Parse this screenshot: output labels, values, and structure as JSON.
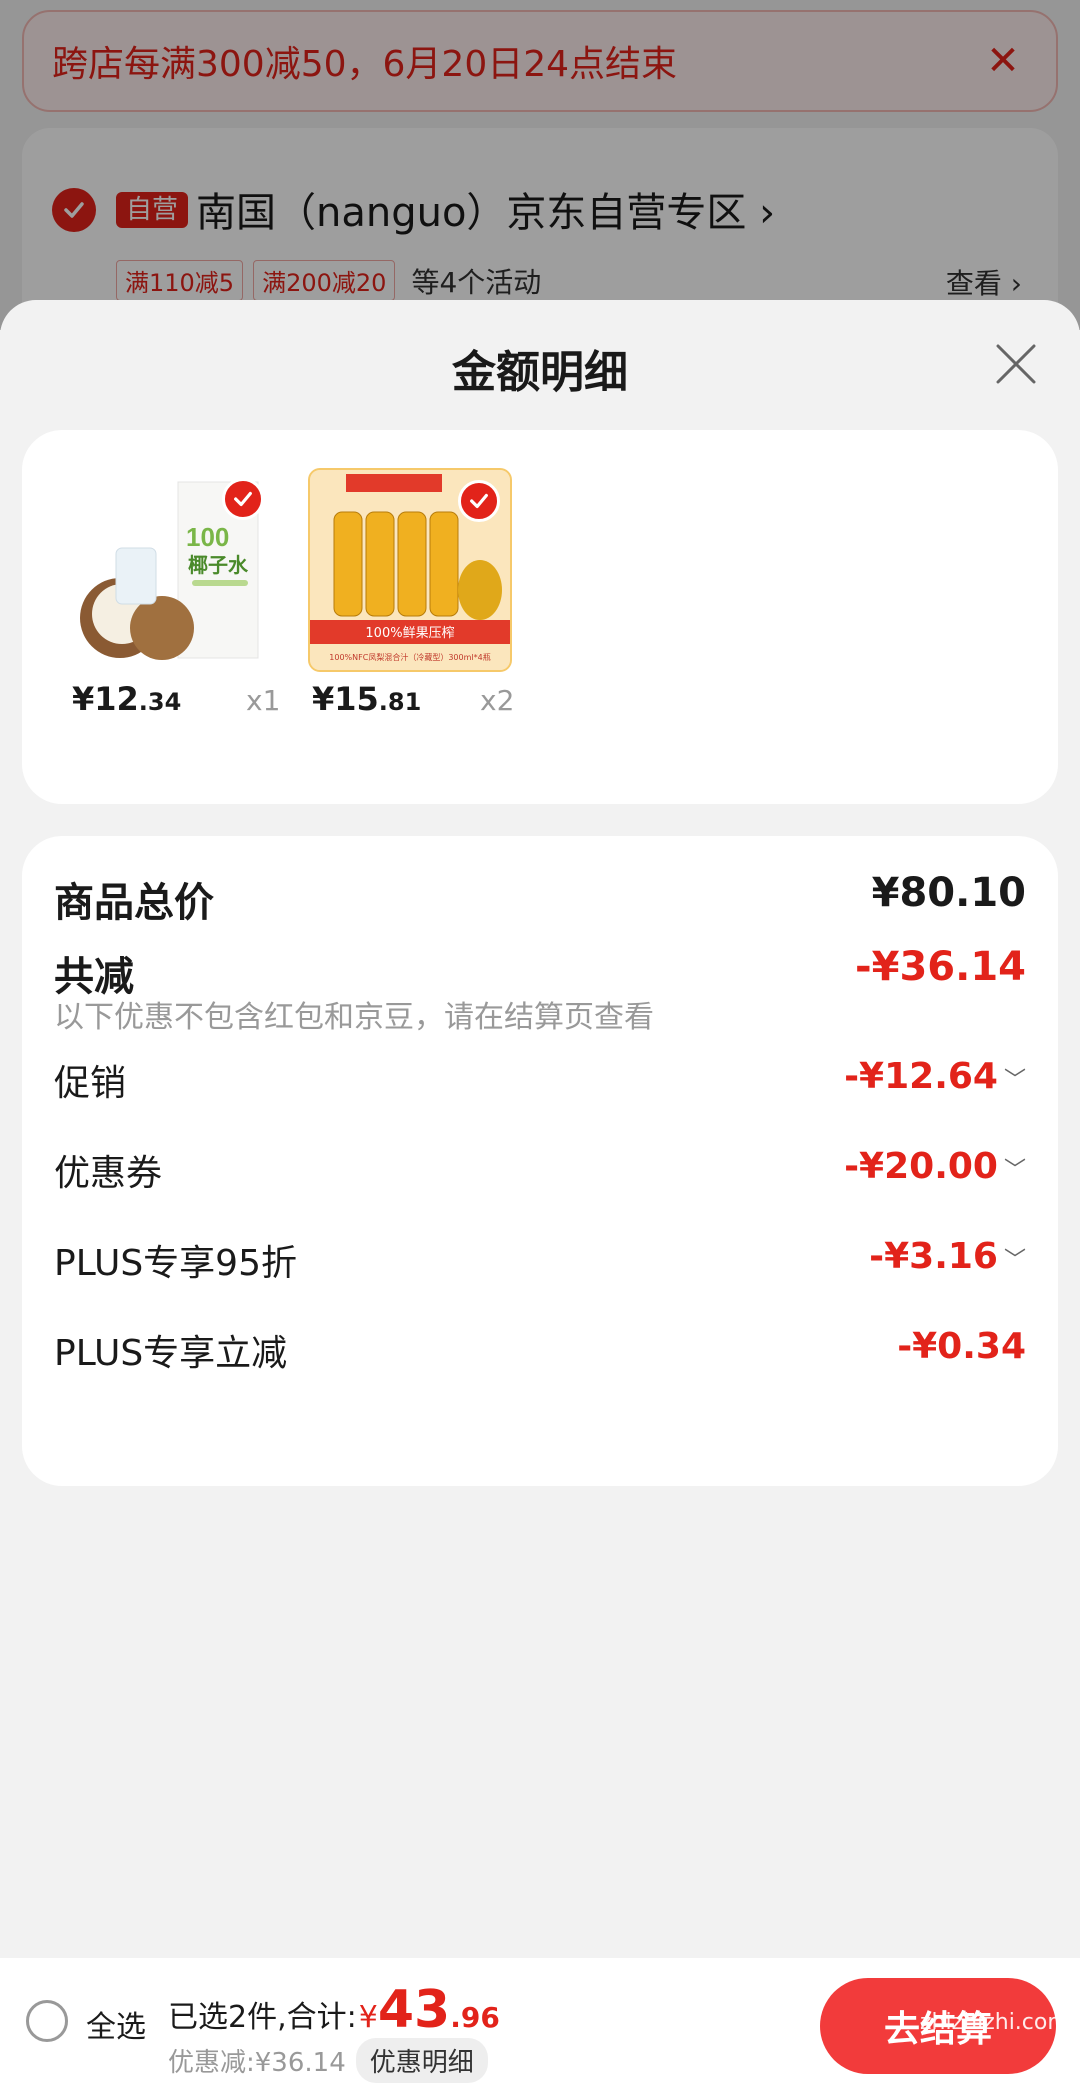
{
  "promo": {
    "text": "跨店每满300减50，6月20日24点结束",
    "close": "✕"
  },
  "shop": {
    "badge": "自营",
    "name": "南国（nanguo）京东自营专区 ›",
    "tags": [
      "满110减5",
      "满200减20"
    ],
    "tags_more": "等4个活动",
    "view": "查看 ›"
  },
  "sheet": {
    "title": "金额明细"
  },
  "products": [
    {
      "price_main": "¥12",
      "price_small": ".34",
      "qty": "x1",
      "name": "coconut-water",
      "label_top": "100",
      "label_main": "椰子水"
    },
    {
      "price_main": "¥15",
      "price_small": ".81",
      "qty": "x2",
      "name": "nfc-juice",
      "label_top": "100%鲜果压榨",
      "label_main": "100%NFC凤梨混合汁（冷藏型）300ml*4瓶"
    }
  ],
  "summary": {
    "total_label": "商品总价",
    "total_value": "¥80.10",
    "reduce_label": "共减",
    "reduce_value": "-¥36.14",
    "note": "以下优惠不包含红包和京豆，请在结算页查看",
    "rows": [
      {
        "label": "促销",
        "value": "-¥12.64",
        "chev": "﹀"
      },
      {
        "label": "优惠券",
        "value": "-¥20.00",
        "chev": "﹀"
      },
      {
        "label": "PLUS专享95折",
        "value": "-¥3.16",
        "chev": "﹀"
      },
      {
        "label": "PLUS专享立减",
        "value": "-¥0.34",
        "chev": ""
      }
    ]
  },
  "bottom": {
    "select_all": "全选",
    "selected": "已选2件,合计:",
    "yen": "¥",
    "total_big": "43",
    "total_small": ".96",
    "discount": "优惠减:¥36.14",
    "detail_btn": "优惠明细",
    "checkout": "去结算"
  },
  "watermark": "zhizhizhi.com",
  "colors": {
    "accent": "#e2231a",
    "bg": "#f2f2f2"
  }
}
